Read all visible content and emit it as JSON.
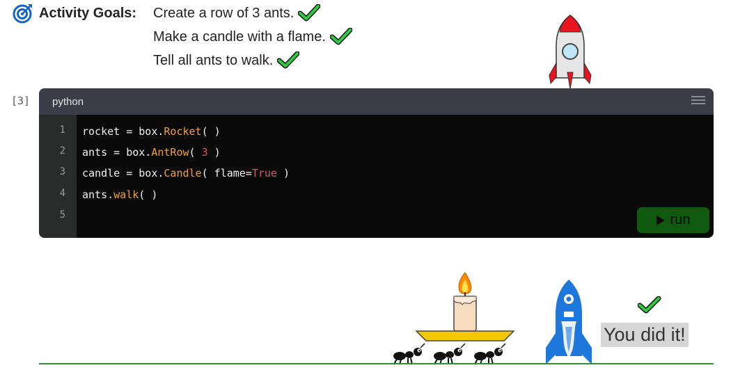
{
  "goals": {
    "label": "Activity Goals:",
    "items": [
      {
        "text": "Create a row of 3 ants.",
        "done": true
      },
      {
        "text": "Make a candle with a flame.",
        "done": true
      },
      {
        "text": "Tell all ants to walk.",
        "done": true
      }
    ]
  },
  "cell": {
    "count_label": "[3]",
    "language": "python",
    "run_label": "run",
    "line_numbers": [
      "1",
      "2",
      "3",
      "4",
      "5"
    ]
  },
  "code": {
    "l1": {
      "a": "rocket = box.",
      "fn": "Rocket",
      "b": "( )"
    },
    "l2": {
      "a": "ants = box.",
      "fn": "AntRow",
      "b": "( ",
      "num": "3",
      "c": " )"
    },
    "l3": {
      "a": "candle = box.",
      "fn": "Candle",
      "b": "( flame=",
      "kw": "True",
      "c": " )"
    },
    "l4": {
      "a": "ants.",
      "fn": "walk",
      "b": "( )"
    }
  },
  "scene": {
    "success_text": "You did it!",
    "success_check": true
  },
  "colors": {
    "check_green": "#2ecc40",
    "run_button": "#0f5a0f",
    "editor_bg": "#0a0a0a",
    "rocket_red": "#e8141e",
    "rocket_blue": "#1e78dc",
    "candle_holder": "#f5c800",
    "ground": "#3a8a3a"
  }
}
